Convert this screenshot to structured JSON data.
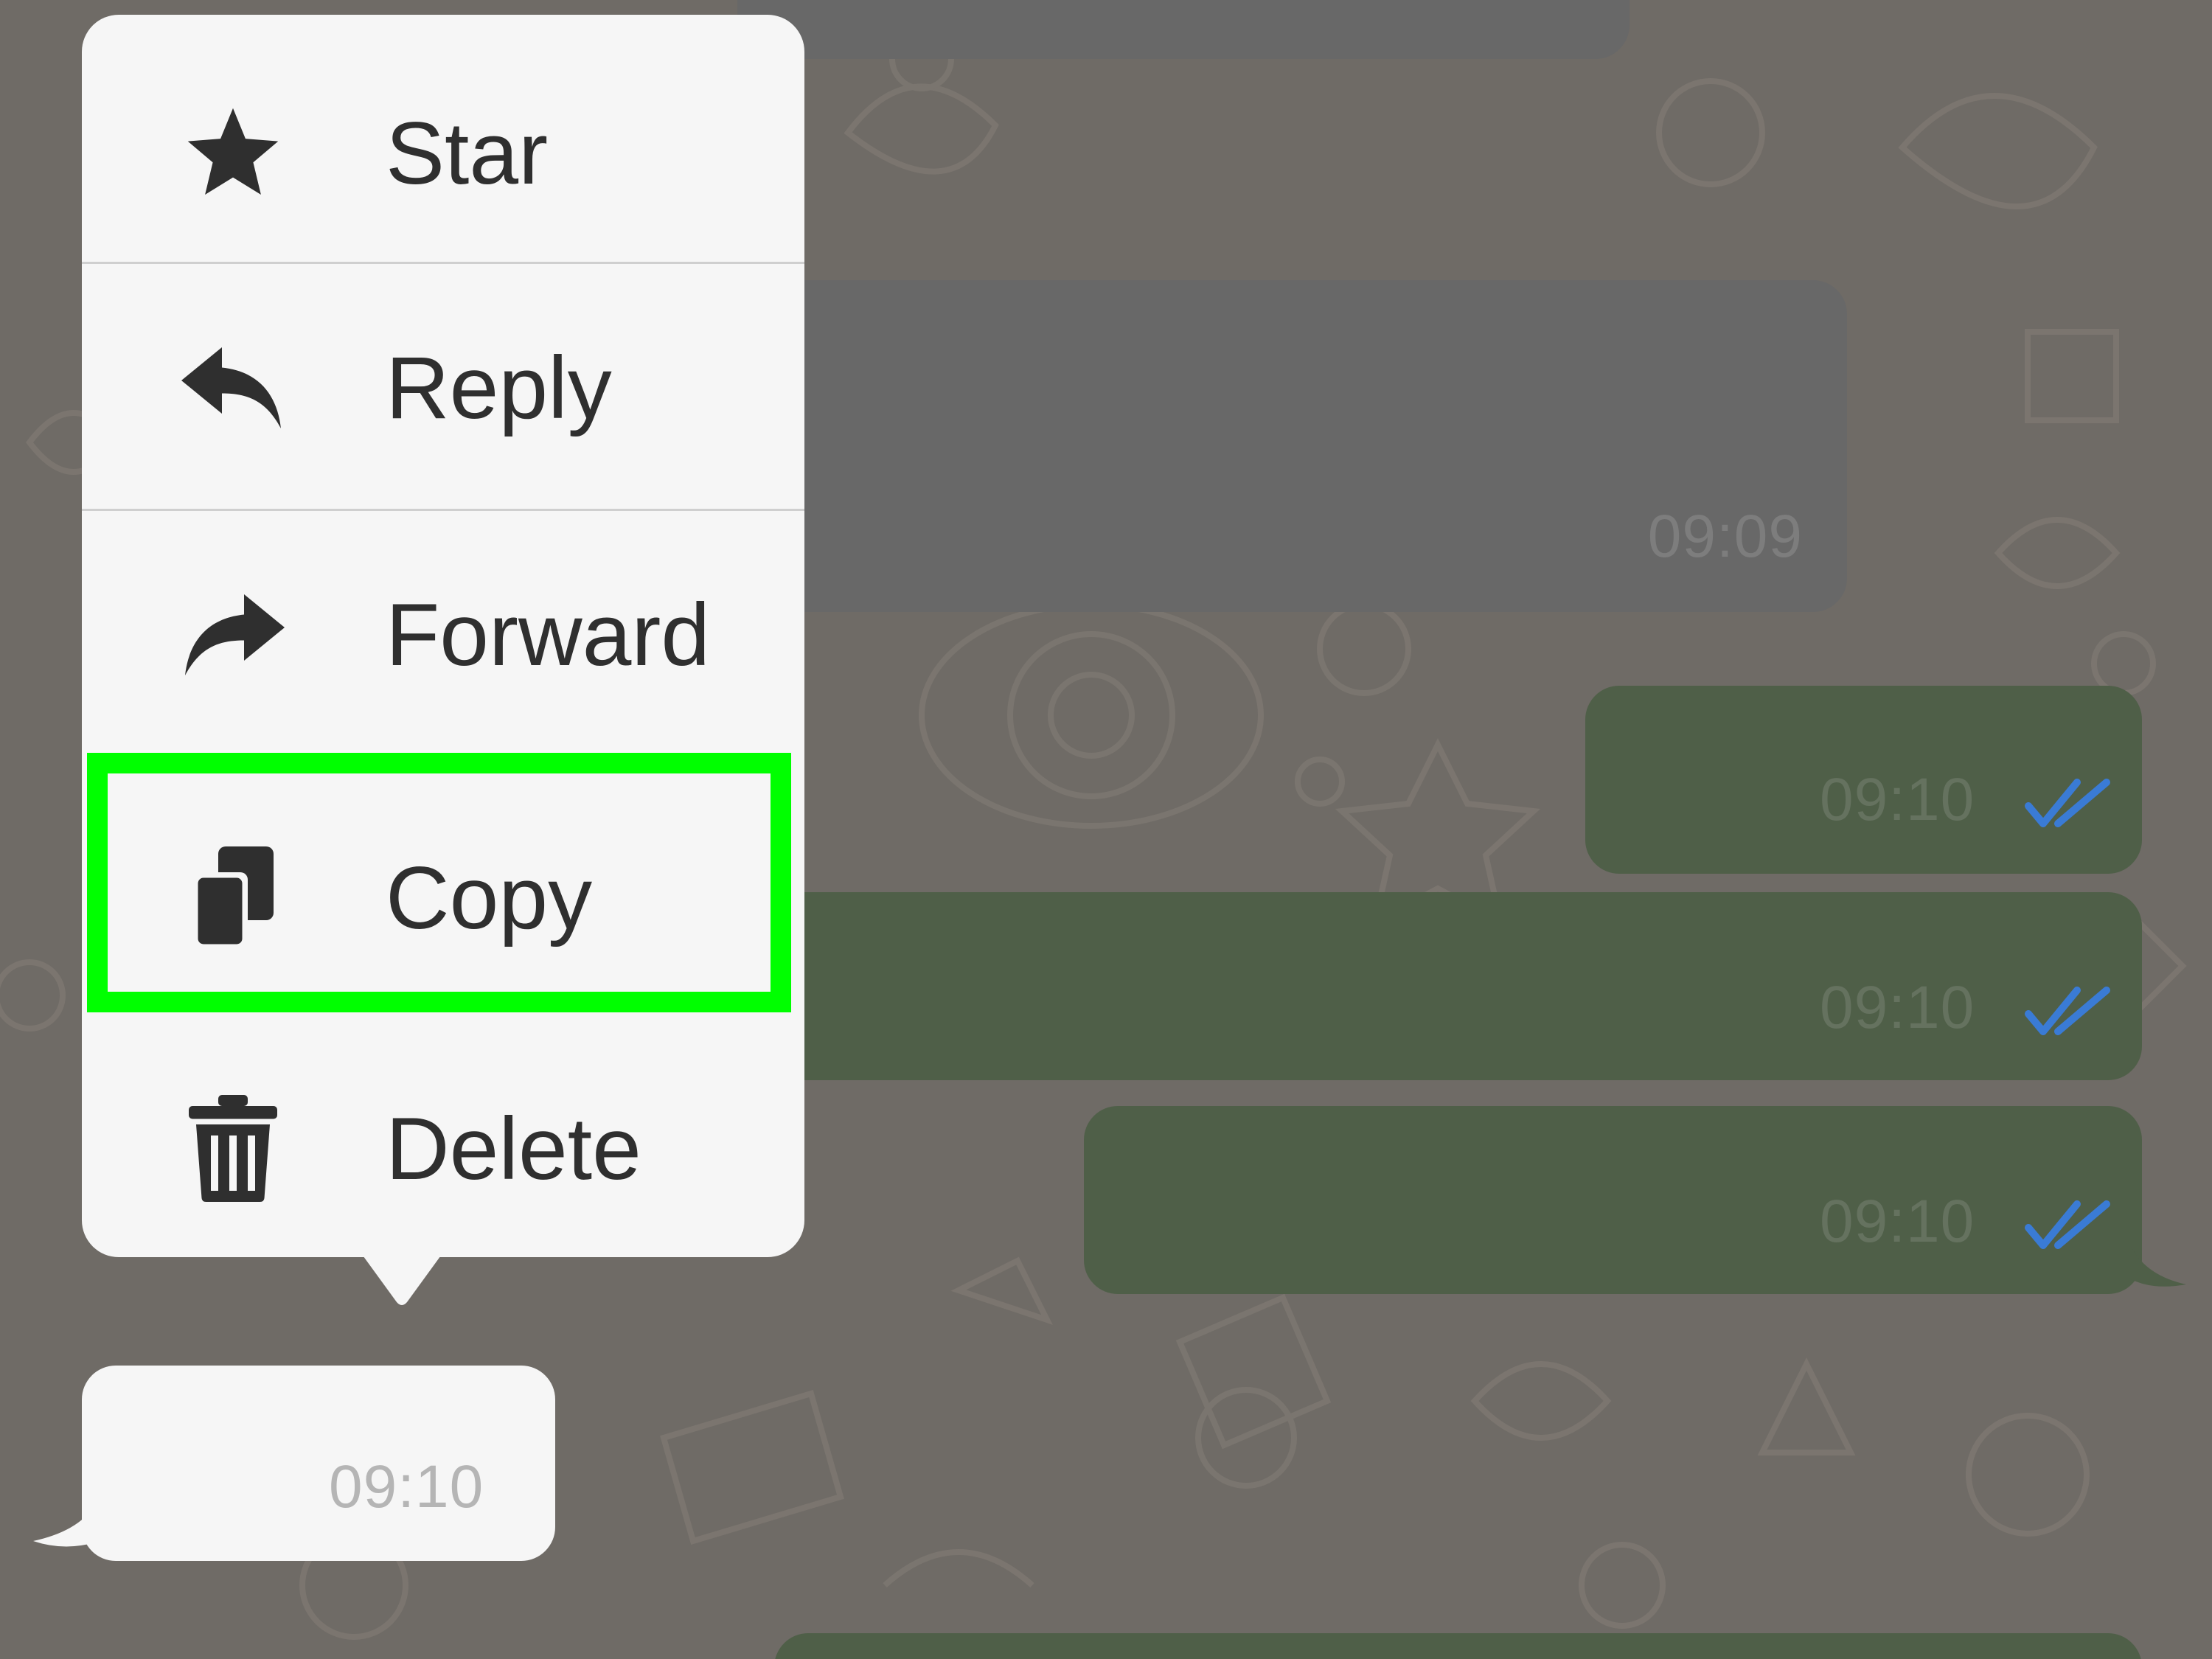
{
  "background": {
    "wallpaper_color": "#6f6b66",
    "doodle_color": "#7c7770"
  },
  "messages": [
    {
      "id": "incoming-top",
      "kind": "incoming",
      "time": ""
    },
    {
      "id": "incoming-1",
      "kind": "incoming",
      "time": "09:09"
    },
    {
      "id": "outgoing-1",
      "kind": "outgoing",
      "time": "09:10",
      "status": "double-check-icon"
    },
    {
      "id": "outgoing-2",
      "kind": "outgoing",
      "time": "09:10",
      "status": "double-check-icon"
    },
    {
      "id": "outgoing-3",
      "kind": "outgoing",
      "time": "09:10",
      "status": "double-check-icon"
    },
    {
      "id": "selected-incoming",
      "kind": "incoming",
      "time": "09:10",
      "selected": true
    }
  ],
  "context_menu": {
    "items": [
      {
        "label": "Star",
        "icon": "star-icon"
      },
      {
        "label": "Reply",
        "icon": "reply-icon"
      },
      {
        "label": "Forward",
        "icon": "forward-icon"
      },
      {
        "label": "Copy",
        "icon": "copy-icon",
        "highlighted": true
      },
      {
        "label": "Delete",
        "icon": "trash-icon"
      }
    ],
    "highlight_color": "#00ff00",
    "highlighted_item": "Copy"
  },
  "colors": {
    "menu_background": "#f6f6f6",
    "menu_text": "#2f2f2f",
    "check_blue": "#3a7bd5",
    "incoming_dim": "#686868",
    "outgoing_dim": "#4f5f48"
  }
}
